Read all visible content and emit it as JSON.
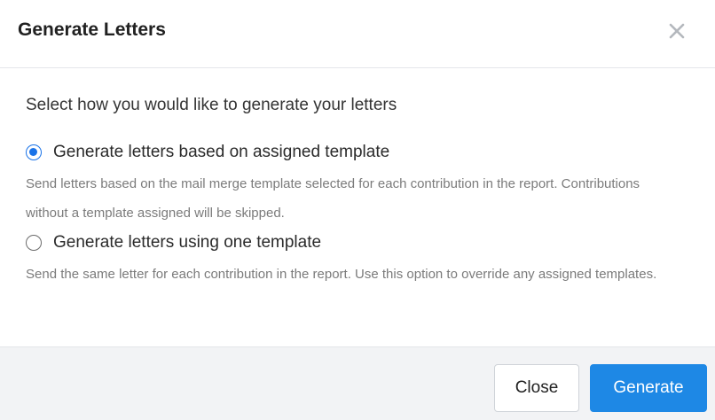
{
  "dialog": {
    "title": "Generate Letters",
    "close_icon": "close-icon"
  },
  "body": {
    "prompt": "Select how you would like to generate your letters",
    "options": [
      {
        "label": "Generate letters based on assigned template",
        "description": "Send letters based on the mail merge template selected for each contribution in the report. Contributions without a template assigned will be skipped.",
        "selected": true
      },
      {
        "label": "Generate letters using one template",
        "description": "Send the same letter for each contribution in the report. Use this option to override any assigned templates.",
        "selected": false
      }
    ]
  },
  "footer": {
    "close_label": "Close",
    "generate_label": "Generate"
  },
  "colors": {
    "accent": "#1e88e5",
    "radio_selected": "#1a73e8",
    "footer_bg": "#f2f3f5",
    "description_text": "#7b7b7b"
  }
}
